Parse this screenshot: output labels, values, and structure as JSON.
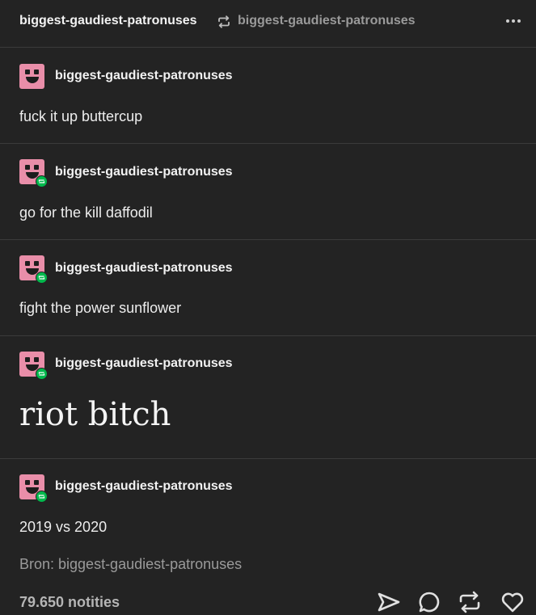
{
  "header": {
    "blog_name": "biggest-gaudiest-patronuses",
    "reblogged_from": "biggest-gaudiest-patronuses",
    "reblog_icon": "reblog-icon",
    "more_icon": "more-options-icon"
  },
  "posts": [
    {
      "username": "biggest-gaudiest-patronuses",
      "text": "fuck it up buttercup",
      "reblog_badge": false
    },
    {
      "username": "biggest-gaudiest-patronuses",
      "text": "go for the kill daffodil",
      "reblog_badge": true
    },
    {
      "username": "biggest-gaudiest-patronuses",
      "text": "fight the power sunflower",
      "reblog_badge": true
    },
    {
      "username": "biggest-gaudiest-patronuses",
      "text": "riot bitch",
      "reblog_badge": true
    },
    {
      "username": "biggest-gaudiest-patronuses",
      "text": "2019 vs 2020",
      "reblog_badge": true
    }
  ],
  "footer": {
    "source": "Bron: biggest-gaudiest-patronuses",
    "notes": "79.650 notities",
    "actions": [
      "share-icon",
      "reply-icon",
      "reblog-icon",
      "like-icon"
    ]
  },
  "colors": {
    "background": "#232323",
    "avatar_pink": "#e98ea9",
    "reblog_green": "#00b84c"
  }
}
